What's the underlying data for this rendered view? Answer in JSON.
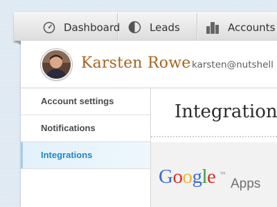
{
  "nav": {
    "items": [
      {
        "label": "Dashboard",
        "icon": "speedometer-icon"
      },
      {
        "label": "Leads",
        "icon": "pie-chart-icon"
      },
      {
        "label": "Accounts",
        "icon": "buildings-icon"
      }
    ]
  },
  "profile": {
    "name": "Karsten Rowe",
    "email": "karsten@nutshell"
  },
  "sidebar": {
    "items": [
      {
        "label": "Account settings",
        "active": false
      },
      {
        "label": "Notifications",
        "active": false
      },
      {
        "label": "Integrations",
        "active": true
      }
    ]
  },
  "content": {
    "title": "Integrations",
    "integration": {
      "logo_letters": [
        "G",
        "o",
        "o",
        "g",
        "l",
        "e"
      ],
      "trademark": "TM",
      "suffix": "Apps"
    }
  },
  "colors": {
    "accent": "#1d88c6",
    "name": "#a4641f",
    "background": "#dbe7f1"
  }
}
